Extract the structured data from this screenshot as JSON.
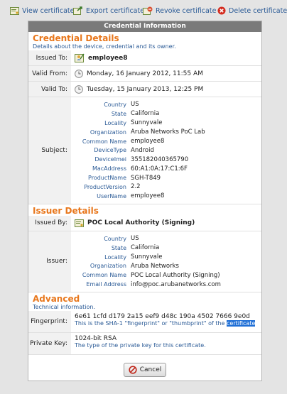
{
  "toolbar": {
    "view": "View certificate",
    "export": "Export certificate",
    "revoke": "Revoke certificate",
    "delete": "Delete certificate"
  },
  "panel": {
    "title": "Credential Information",
    "credential": {
      "title": "Credential Details",
      "subtitle": "Details about the device, credential and its owner.",
      "issued_to_label": "Issued To:",
      "issued_to": "employee8",
      "valid_from_label": "Valid From:",
      "valid_from": "Monday, 16 January 2012, 11:55 AM",
      "valid_to_label": "Valid To:",
      "valid_to": "Tuesday, 15 January 2013, 12:25 PM",
      "subject_label": "Subject:",
      "subject": [
        {
          "k": "Country",
          "v": "US"
        },
        {
          "k": "State",
          "v": "California"
        },
        {
          "k": "Locality",
          "v": "Sunnyvale"
        },
        {
          "k": "Organization",
          "v": "Aruba Networks PoC Lab"
        },
        {
          "k": "Common Name",
          "v": "employee8"
        },
        {
          "k": "DeviceType",
          "v": "Android"
        },
        {
          "k": "DeviceImei",
          "v": "355182040365790"
        },
        {
          "k": "MacAddress",
          "v": "60:A1:0A:17:C1:6F"
        },
        {
          "k": "ProductName",
          "v": "SGH-T849"
        },
        {
          "k": "ProductVersion",
          "v": "2.2"
        },
        {
          "k": "UserName",
          "v": "employee8"
        }
      ]
    },
    "issuer": {
      "title": "Issuer Details",
      "issued_by_label": "Issued By:",
      "issued_by": "POC Local Authority (Signing)",
      "issuer_label": "Issuer:",
      "fields": [
        {
          "k": "Country",
          "v": "US"
        },
        {
          "k": "State",
          "v": "California"
        },
        {
          "k": "Locality",
          "v": "Sunnyvale"
        },
        {
          "k": "Organization",
          "v": "Aruba Networks"
        },
        {
          "k": "Common Name",
          "v": "POC Local Authority (Signing)"
        },
        {
          "k": "Email Address",
          "v": "info@poc.arubanetworks.com"
        }
      ]
    },
    "advanced": {
      "title": "Advanced",
      "subtitle": "Technical information.",
      "fingerprint_label": "Fingerprint:",
      "fingerprint": "6e61 1cfd d179 2a15 eef9 d48c 190a 4502 7666 9e0d",
      "fingerprint_hint_a": "This is the SHA-1 \"fingerprint\" or \"thumbprint\" of the ",
      "fingerprint_hint_b": "certificate",
      "private_key_label": "Private Key:",
      "private_key": "1024-bit RSA",
      "private_key_hint": "The type of the private key for this certificate."
    },
    "cancel": "Cancel"
  }
}
